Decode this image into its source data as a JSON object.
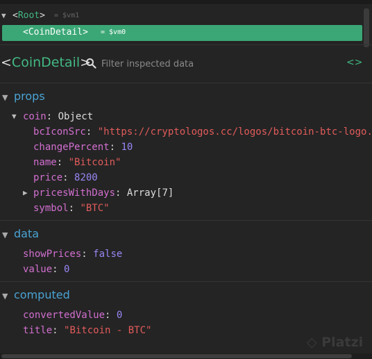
{
  "tree": {
    "root": {
      "arrow": "▼",
      "open": "<",
      "name": "Root",
      "close": ">",
      "ref": "= $vm1"
    },
    "selected": {
      "open": "<",
      "name": "CoinDetail",
      "close": ">",
      "ref": "= $vm0"
    }
  },
  "inspector": {
    "open": "<",
    "name": "CoinDetail",
    "close": ">",
    "search_placeholder": "Filter inspected data",
    "code_icon": "<>"
  },
  "sections": {
    "props": {
      "title": "props",
      "coin_key": "coin",
      "coin_type": "Object",
      "rows": [
        {
          "key": "bcIconSrc",
          "value": "\"https://cryptologos.cc/logos/bitcoin-btc-logo."
        },
        {
          "key": "changePercent",
          "value": "10"
        },
        {
          "key": "name",
          "value": "\"Bitcoin\""
        },
        {
          "key": "price",
          "value": "8200"
        },
        {
          "key": "pricesWithDays",
          "value": "Array[7]"
        },
        {
          "key": "symbol",
          "value": "\"BTC\""
        }
      ]
    },
    "data": {
      "title": "data",
      "rows": [
        {
          "key": "showPrices",
          "value": "false"
        },
        {
          "key": "value",
          "value": "0"
        }
      ]
    },
    "computed": {
      "title": "computed",
      "rows": [
        {
          "key": "convertedValue",
          "value": "0"
        },
        {
          "key": "title",
          "value": "\"Bitcoin - BTC\""
        }
      ]
    }
  },
  "watermark": "Platzi",
  "colors": {
    "accent": "#42b983",
    "selected_bg": "#3ba776",
    "section_title": "#4aa3d3",
    "key": "#d26fd0",
    "string": "#e35b5b",
    "number": "#9a86f5"
  }
}
